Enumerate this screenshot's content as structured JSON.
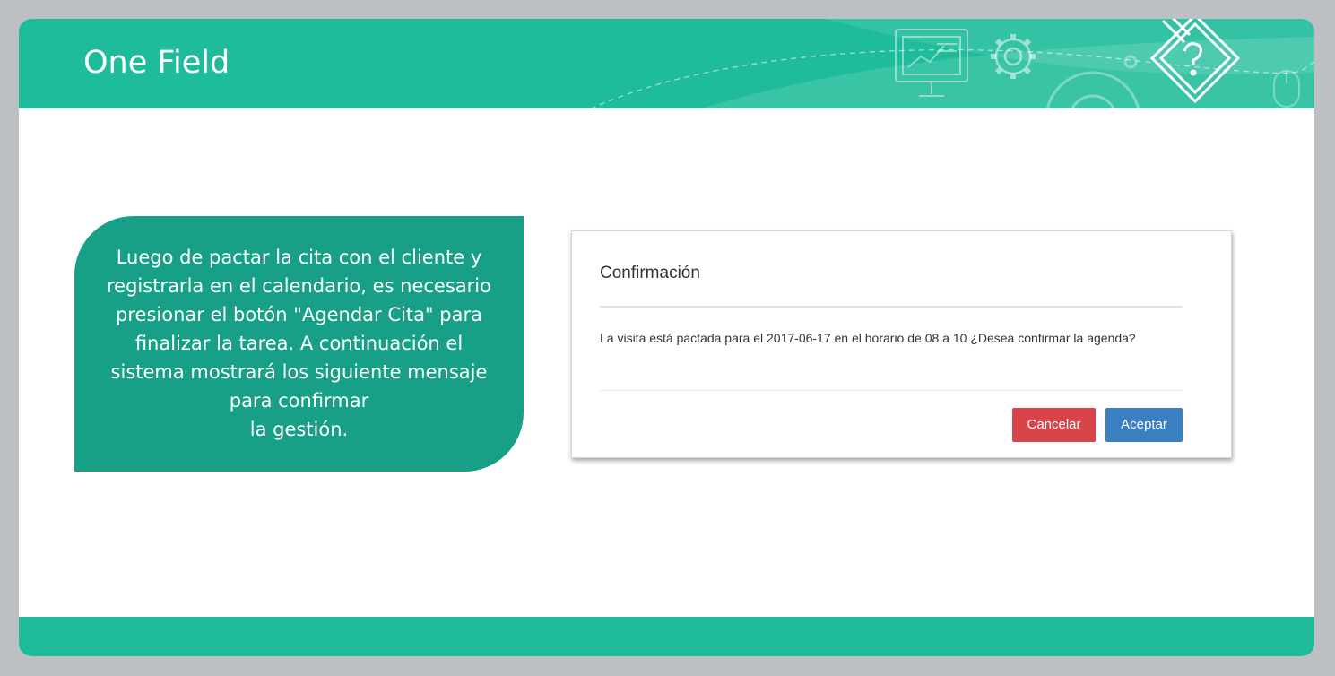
{
  "header": {
    "title": "One Field",
    "decor_icons": [
      "presentation-board-icon",
      "gear-icon",
      "large-gear-icon",
      "pencil-help-document-icon",
      "mouse-icon"
    ]
  },
  "callout": {
    "lines": [
      "Luego de pactar la cita con el cliente y",
      "registrarla en el calendario, es necesario",
      "presionar el botón \"Agendar Cita\" para",
      "finalizar la tarea. A continuación el",
      "sistema mostrará los siguiente mensaje",
      "para confirmar",
      "la gestión."
    ]
  },
  "dialog": {
    "title": "Confirmación",
    "message": "La visita está pactada para el 2017-06-17 en el horario de 08 a 10 ¿Desea confirmar la agenda?",
    "cancel_label": "Cancelar",
    "accept_label": "Aceptar"
  },
  "colors": {
    "page_background": "#bdc0c3",
    "brand_teal": "#1ebc9a",
    "callout_teal": "#17a085",
    "cancel_red": "#d9434a",
    "accept_blue": "#3a7fc1"
  }
}
